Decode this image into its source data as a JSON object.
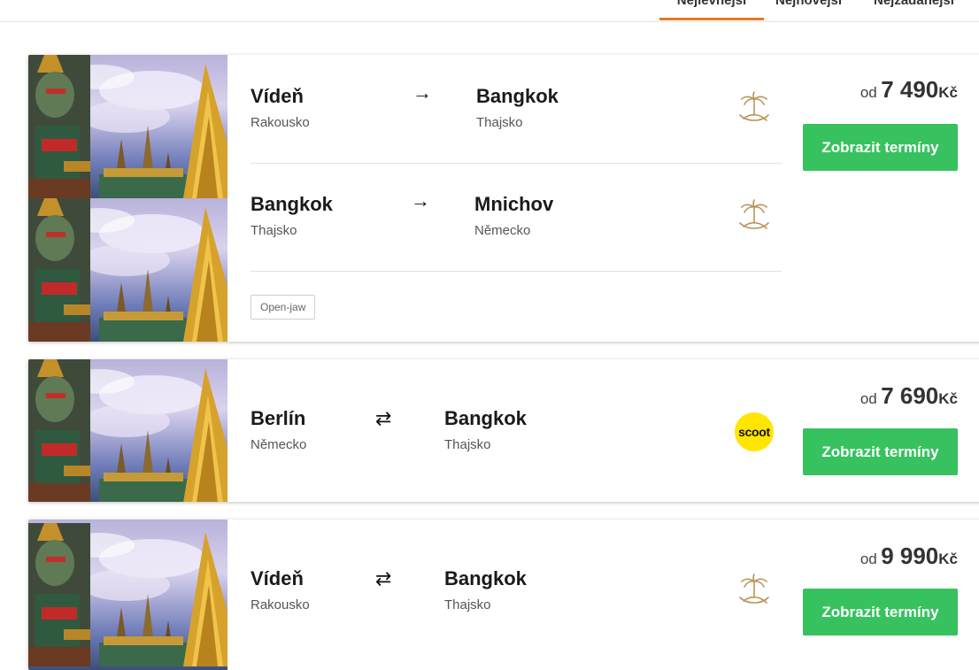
{
  "tabs": [
    {
      "label": "Nejlevnější",
      "active": true
    },
    {
      "label": "Nejnovější",
      "active": false
    },
    {
      "label": "Nejžádanější",
      "active": false
    }
  ],
  "offers": [
    {
      "legs": [
        {
          "from_city": "Vídeň",
          "from_country": "Rakousko",
          "arrow": "→",
          "to_city": "Bangkok",
          "to_country": "Thajsko",
          "airline_icon": "saudia-palm-logo"
        },
        {
          "from_city": "Bangkok",
          "from_country": "Thajsko",
          "arrow": "→",
          "to_city": "Mnichov",
          "to_country": "Německo",
          "airline_icon": "saudia-palm-logo"
        }
      ],
      "tag": "Open-jaw",
      "price_prefix": "od",
      "price": "7 490",
      "currency": "Kč",
      "button": "Zobrazit termíny"
    },
    {
      "legs": [
        {
          "from_city": "Berlín",
          "from_country": "Německo",
          "arrow": "⇄",
          "to_city": "Bangkok",
          "to_country": "Thajsko",
          "airline_icon": "scoot-logo",
          "airline_text": "scoot"
        }
      ],
      "price_prefix": "od",
      "price": "7 690",
      "currency": "Kč",
      "button": "Zobrazit termíny"
    },
    {
      "legs": [
        {
          "from_city": "Vídeň",
          "from_country": "Rakousko",
          "arrow": "⇄",
          "to_city": "Bangkok",
          "to_country": "Thajsko",
          "airline_icon": "saudia-palm-logo"
        }
      ],
      "price_prefix": "od",
      "price": "9 990",
      "currency": "Kč",
      "button": "Zobrazit termíny"
    }
  ],
  "colors": {
    "accent": "#e87722",
    "button": "#37c25f",
    "airline_gold": "#b8955a",
    "scoot_yellow": "#ffe500"
  }
}
